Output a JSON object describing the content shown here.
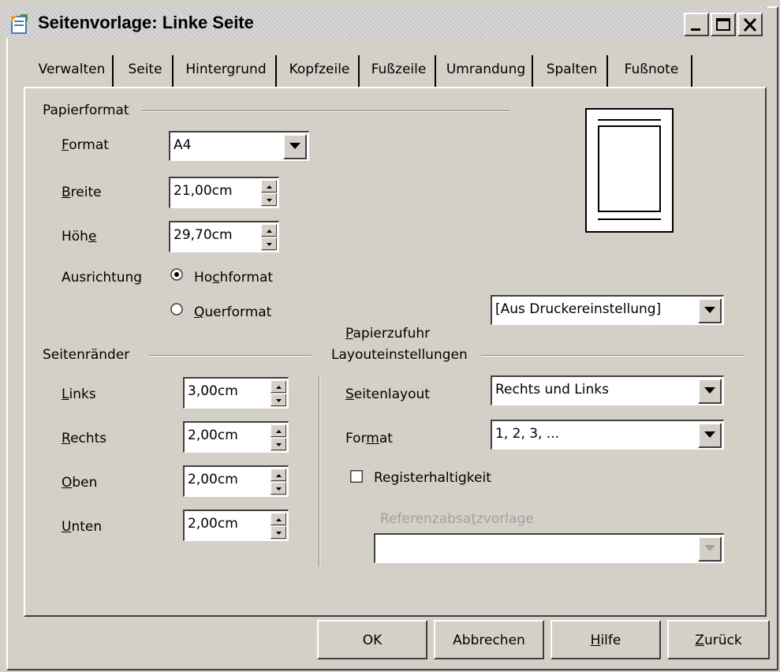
{
  "window": {
    "title": "Seitenvorlage: Linke Seite"
  },
  "tabs": [
    {
      "label": "Verwalten"
    },
    {
      "label": "Seite"
    },
    {
      "label": "Hintergrund"
    },
    {
      "label": "Kopfzeile"
    },
    {
      "label": "Fußzeile"
    },
    {
      "label": "Umrandung"
    },
    {
      "label": "Spalten"
    },
    {
      "label": "Fußnote"
    }
  ],
  "active_tab": "Seite",
  "paper": {
    "group_label": "Papierformat",
    "format_label": "Format",
    "format_value": "A4",
    "width_label": "Breite",
    "width_value": "21,00cm",
    "height_label": "Höhe",
    "height_value": "29,70cm",
    "orientation_label": "Ausrichtung",
    "portrait_label": "Hochformat",
    "landscape_label": "Querformat",
    "orientation_selected": "Hochformat",
    "tray_label": "Papierzufuhr",
    "tray_value": "[Aus Druckereinstellung]"
  },
  "margins": {
    "group_label": "Seitenränder",
    "left_label": "Links",
    "left_value": "3,00cm",
    "right_label": "Rechts",
    "right_value": "2,00cm",
    "top_label": "Oben",
    "top_value": "2,00cm",
    "bottom_label": "Unten",
    "bottom_value": "2,00cm"
  },
  "layout": {
    "group_label": "Layouteinstellungen",
    "page_layout_label": "Seitenlayout",
    "page_layout_value": "Rechts und Links",
    "format_label": "Format",
    "format_value": "1, 2, 3, ...",
    "register_label": "Registerhaltigkeit",
    "register_checked": false,
    "reference_label": "Referenzabsatzvorlage",
    "reference_value": ""
  },
  "buttons": {
    "ok": "OK",
    "cancel": "Abbrechen",
    "help": "Hilfe",
    "back": "Zurück"
  },
  "icons": {
    "app": "document-icon",
    "minimize": "minimize-icon",
    "maximize": "maximize-icon",
    "close": "close-icon"
  }
}
